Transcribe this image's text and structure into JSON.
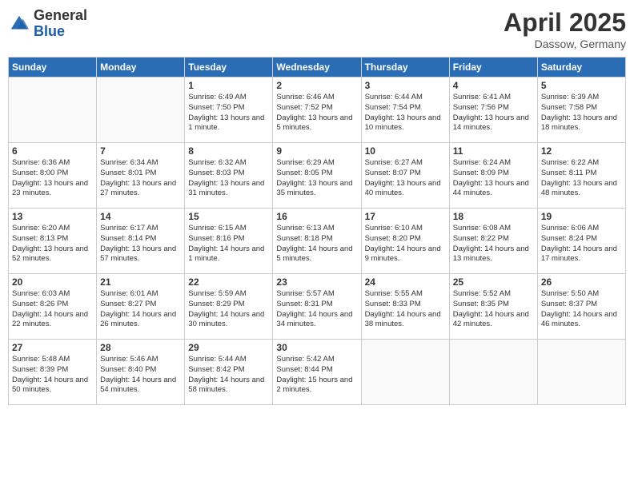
{
  "header": {
    "logo_general": "General",
    "logo_blue": "Blue",
    "month_title": "April 2025",
    "location": "Dassow, Germany"
  },
  "days_of_week": [
    "Sunday",
    "Monday",
    "Tuesday",
    "Wednesday",
    "Thursday",
    "Friday",
    "Saturday"
  ],
  "weeks": [
    [
      {
        "day": "",
        "info": ""
      },
      {
        "day": "",
        "info": ""
      },
      {
        "day": "1",
        "info": "Sunrise: 6:49 AM\nSunset: 7:50 PM\nDaylight: 13 hours and 1 minute."
      },
      {
        "day": "2",
        "info": "Sunrise: 6:46 AM\nSunset: 7:52 PM\nDaylight: 13 hours and 5 minutes."
      },
      {
        "day": "3",
        "info": "Sunrise: 6:44 AM\nSunset: 7:54 PM\nDaylight: 13 hours and 10 minutes."
      },
      {
        "day": "4",
        "info": "Sunrise: 6:41 AM\nSunset: 7:56 PM\nDaylight: 13 hours and 14 minutes."
      },
      {
        "day": "5",
        "info": "Sunrise: 6:39 AM\nSunset: 7:58 PM\nDaylight: 13 hours and 18 minutes."
      }
    ],
    [
      {
        "day": "6",
        "info": "Sunrise: 6:36 AM\nSunset: 8:00 PM\nDaylight: 13 hours and 23 minutes."
      },
      {
        "day": "7",
        "info": "Sunrise: 6:34 AM\nSunset: 8:01 PM\nDaylight: 13 hours and 27 minutes."
      },
      {
        "day": "8",
        "info": "Sunrise: 6:32 AM\nSunset: 8:03 PM\nDaylight: 13 hours and 31 minutes."
      },
      {
        "day": "9",
        "info": "Sunrise: 6:29 AM\nSunset: 8:05 PM\nDaylight: 13 hours and 35 minutes."
      },
      {
        "day": "10",
        "info": "Sunrise: 6:27 AM\nSunset: 8:07 PM\nDaylight: 13 hours and 40 minutes."
      },
      {
        "day": "11",
        "info": "Sunrise: 6:24 AM\nSunset: 8:09 PM\nDaylight: 13 hours and 44 minutes."
      },
      {
        "day": "12",
        "info": "Sunrise: 6:22 AM\nSunset: 8:11 PM\nDaylight: 13 hours and 48 minutes."
      }
    ],
    [
      {
        "day": "13",
        "info": "Sunrise: 6:20 AM\nSunset: 8:13 PM\nDaylight: 13 hours and 52 minutes."
      },
      {
        "day": "14",
        "info": "Sunrise: 6:17 AM\nSunset: 8:14 PM\nDaylight: 13 hours and 57 minutes."
      },
      {
        "day": "15",
        "info": "Sunrise: 6:15 AM\nSunset: 8:16 PM\nDaylight: 14 hours and 1 minute."
      },
      {
        "day": "16",
        "info": "Sunrise: 6:13 AM\nSunset: 8:18 PM\nDaylight: 14 hours and 5 minutes."
      },
      {
        "day": "17",
        "info": "Sunrise: 6:10 AM\nSunset: 8:20 PM\nDaylight: 14 hours and 9 minutes."
      },
      {
        "day": "18",
        "info": "Sunrise: 6:08 AM\nSunset: 8:22 PM\nDaylight: 14 hours and 13 minutes."
      },
      {
        "day": "19",
        "info": "Sunrise: 6:06 AM\nSunset: 8:24 PM\nDaylight: 14 hours and 17 minutes."
      }
    ],
    [
      {
        "day": "20",
        "info": "Sunrise: 6:03 AM\nSunset: 8:26 PM\nDaylight: 14 hours and 22 minutes."
      },
      {
        "day": "21",
        "info": "Sunrise: 6:01 AM\nSunset: 8:27 PM\nDaylight: 14 hours and 26 minutes."
      },
      {
        "day": "22",
        "info": "Sunrise: 5:59 AM\nSunset: 8:29 PM\nDaylight: 14 hours and 30 minutes."
      },
      {
        "day": "23",
        "info": "Sunrise: 5:57 AM\nSunset: 8:31 PM\nDaylight: 14 hours and 34 minutes."
      },
      {
        "day": "24",
        "info": "Sunrise: 5:55 AM\nSunset: 8:33 PM\nDaylight: 14 hours and 38 minutes."
      },
      {
        "day": "25",
        "info": "Sunrise: 5:52 AM\nSunset: 8:35 PM\nDaylight: 14 hours and 42 minutes."
      },
      {
        "day": "26",
        "info": "Sunrise: 5:50 AM\nSunset: 8:37 PM\nDaylight: 14 hours and 46 minutes."
      }
    ],
    [
      {
        "day": "27",
        "info": "Sunrise: 5:48 AM\nSunset: 8:39 PM\nDaylight: 14 hours and 50 minutes."
      },
      {
        "day": "28",
        "info": "Sunrise: 5:46 AM\nSunset: 8:40 PM\nDaylight: 14 hours and 54 minutes."
      },
      {
        "day": "29",
        "info": "Sunrise: 5:44 AM\nSunset: 8:42 PM\nDaylight: 14 hours and 58 minutes."
      },
      {
        "day": "30",
        "info": "Sunrise: 5:42 AM\nSunset: 8:44 PM\nDaylight: 15 hours and 2 minutes."
      },
      {
        "day": "",
        "info": ""
      },
      {
        "day": "",
        "info": ""
      },
      {
        "day": "",
        "info": ""
      }
    ]
  ]
}
